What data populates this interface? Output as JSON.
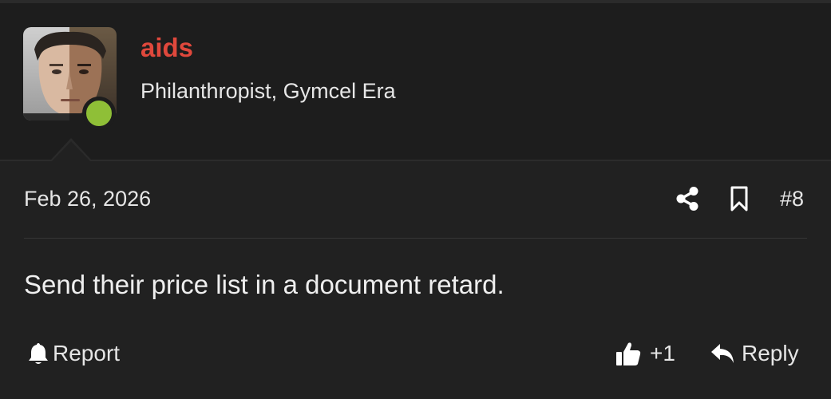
{
  "author": {
    "username": "aids",
    "title": "Philanthropist, Gymcel Era",
    "online": true
  },
  "post": {
    "date": "Feb 26, 2026",
    "number": "#8",
    "message": "Send their price list in a document retard."
  },
  "actions": {
    "report_label": "Report",
    "like_count": "+1",
    "reply_label": "Reply"
  },
  "colors": {
    "background": "#212121",
    "username": "#e0483c",
    "online_dot": "#8fbf37",
    "text": "#e6e6e6"
  },
  "icons": {
    "share": "share-icon",
    "bookmark": "bookmark-icon",
    "report": "bell-icon",
    "like": "thumbs-up-icon",
    "reply": "reply-icon"
  }
}
